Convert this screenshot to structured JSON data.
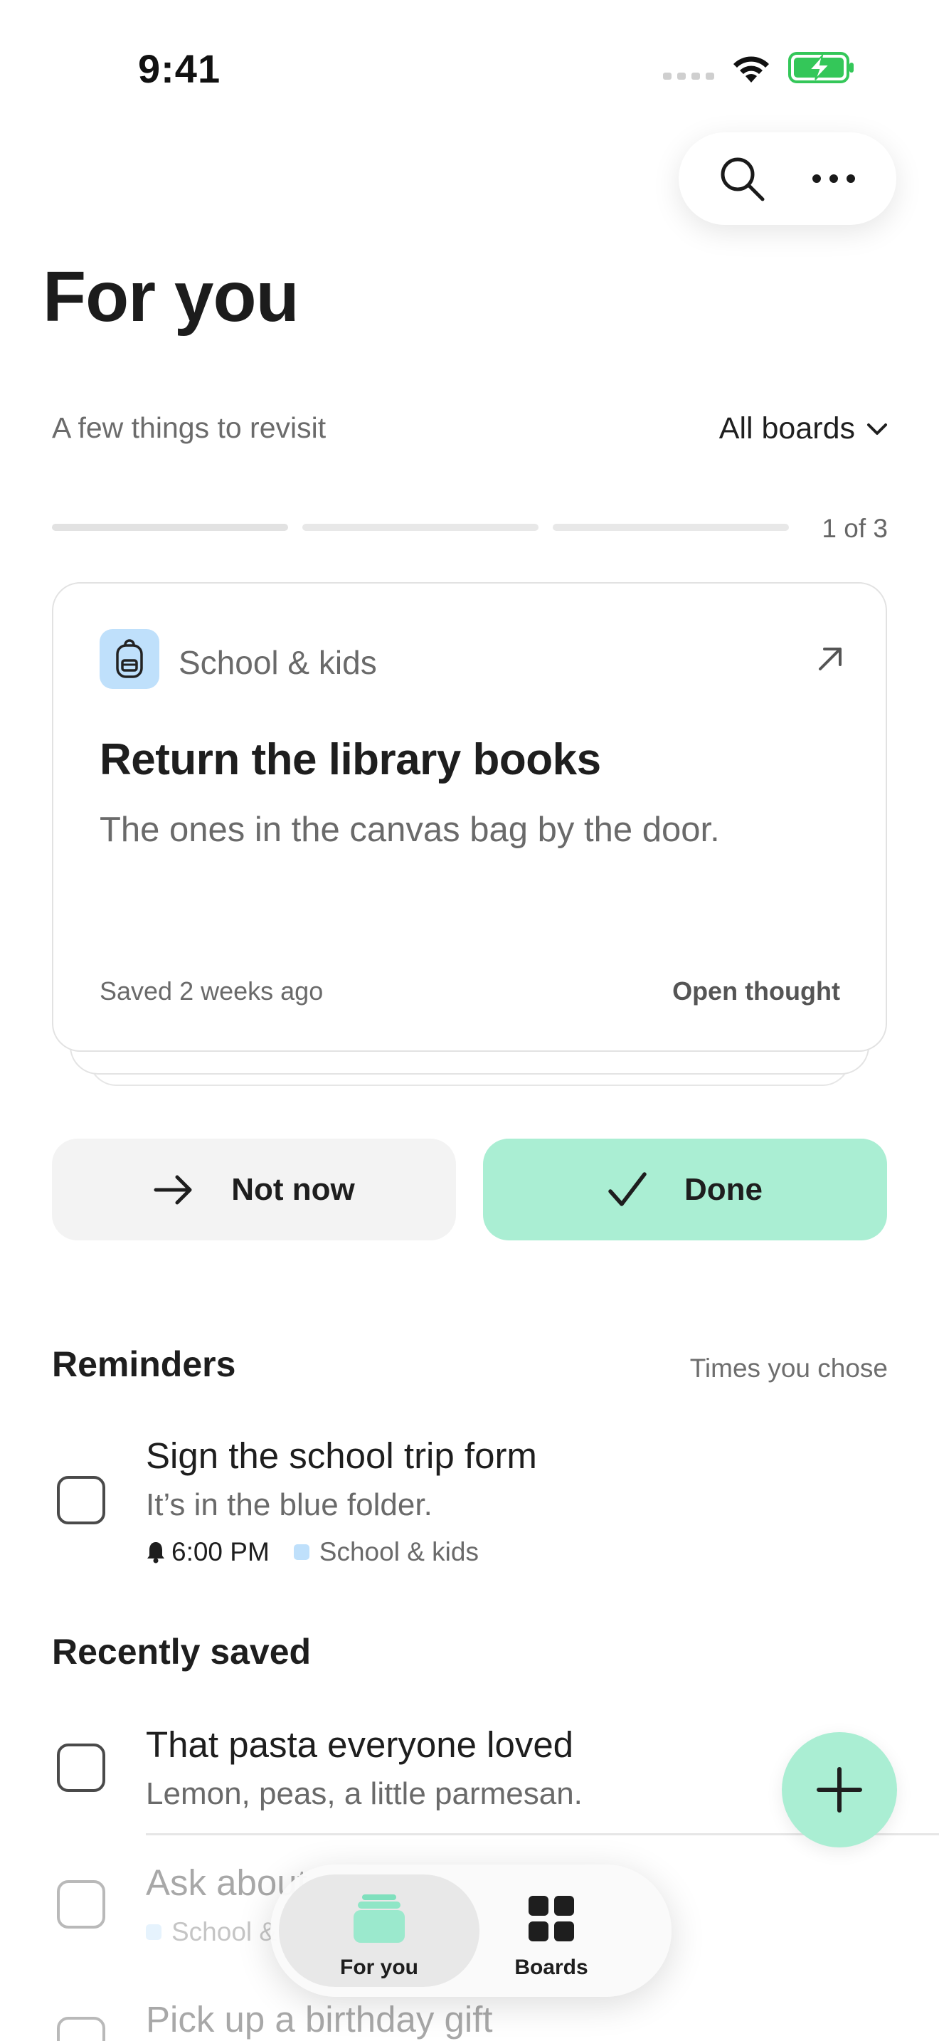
{
  "status_bar": {
    "time": "9:41"
  },
  "header": {
    "title": "For you"
  },
  "top_actions": {
    "search_icon": "search-icon",
    "more_icon": "more-horizontal-icon"
  },
  "review": {
    "subtitle": "A few things to revisit",
    "board_filter": "All boards",
    "progress": {
      "current": 1,
      "total": 3,
      "label": "1 of 3"
    },
    "card": {
      "board": "School & kids",
      "board_icon": "backpack-icon",
      "title": "Return the library books",
      "body": "The ones in the canvas bag by the door.",
      "saved": "Saved 2 weeks ago",
      "open_label": "Open thought"
    },
    "not_now_label": "Not now",
    "done_label": "Done"
  },
  "reminders": {
    "title": "Reminders",
    "hint": "Times you chose",
    "items": [
      {
        "title": "Sign the school trip form",
        "note": "It’s in the blue folder.",
        "time": "6:00 PM",
        "board": "School & kids"
      }
    ]
  },
  "recently_saved": {
    "title": "Recently saved",
    "items": [
      {
        "title": "That pasta everyone loved",
        "note": "Lemon, peas, a little parmesan."
      },
      {
        "title": "Ask about",
        "board": "School &"
      },
      {
        "title": "Pick up a birthday gift"
      }
    ]
  },
  "tabbar": {
    "tabs": [
      {
        "label": "For you",
        "active": true
      },
      {
        "label": "Boards",
        "active": false
      }
    ]
  },
  "colors": {
    "accent": "#aaeed3",
    "board_school": "#bfe0fb",
    "battery": "#34c759"
  }
}
